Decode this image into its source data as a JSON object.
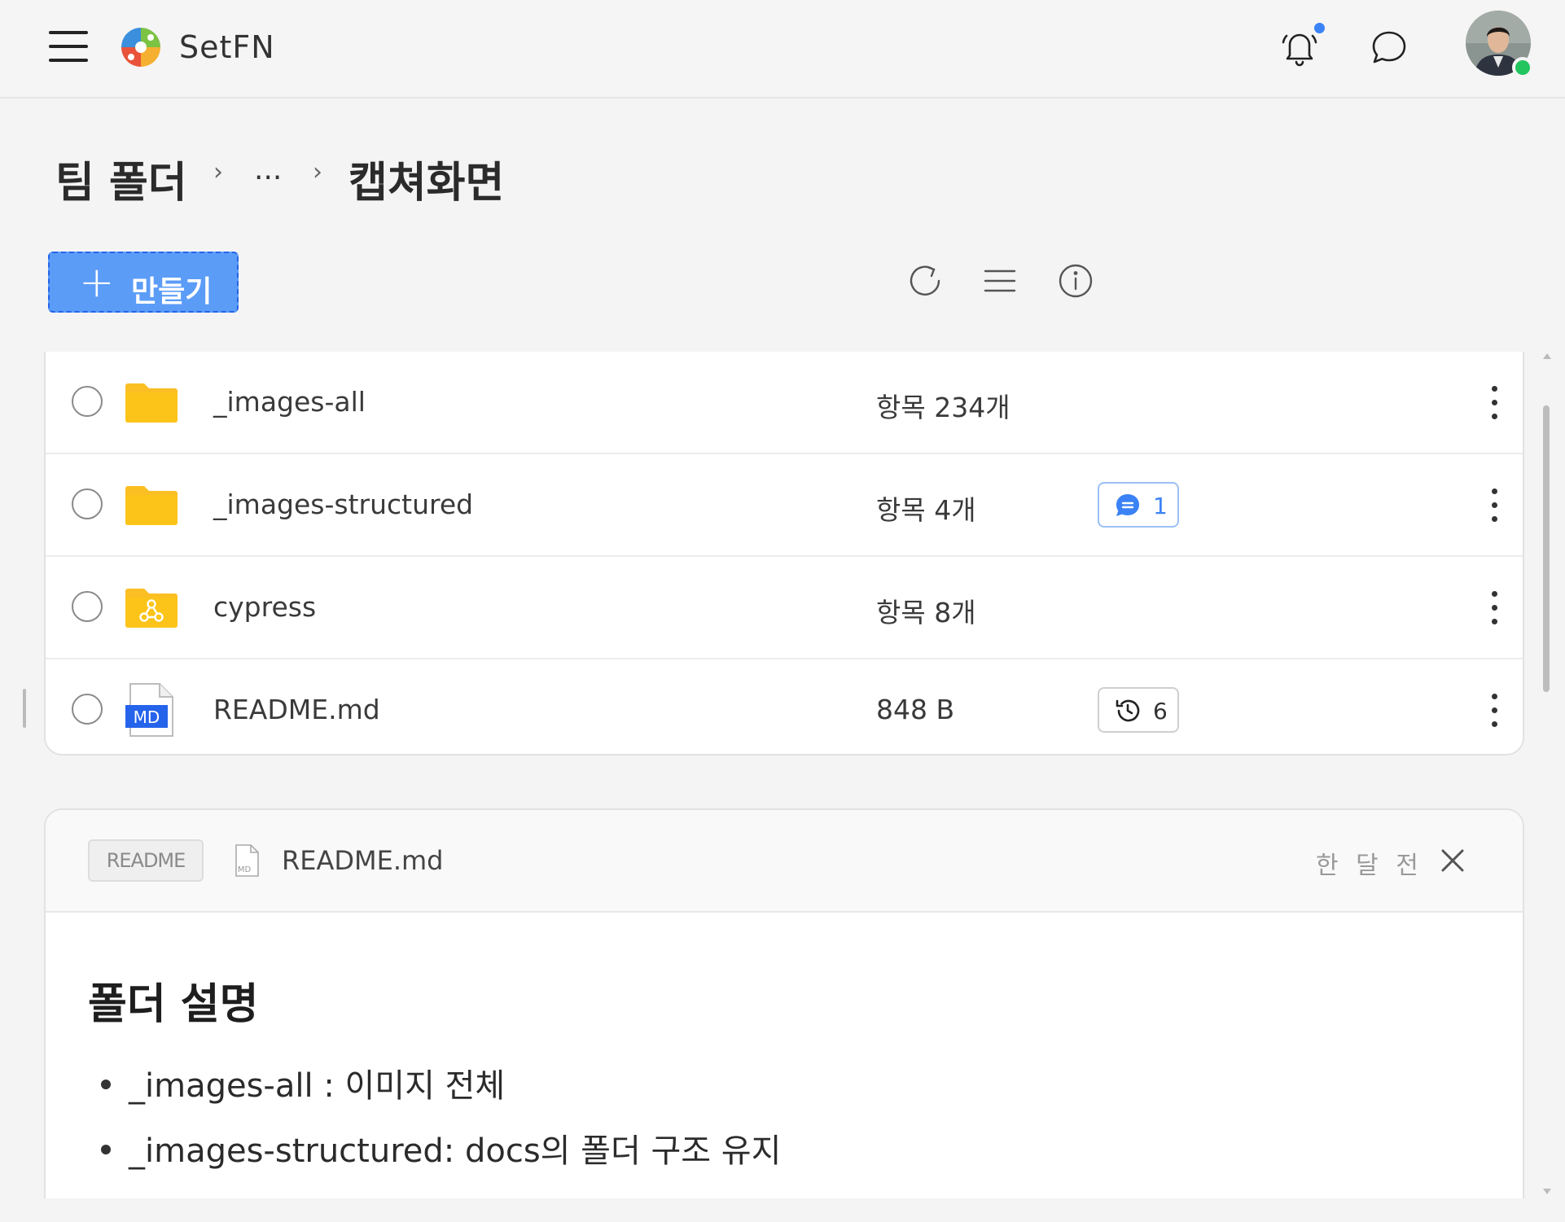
{
  "header": {
    "app_name": "SetFN",
    "icons": [
      "menu-icon",
      "logo-icon",
      "bell-icon",
      "chat-icon"
    ],
    "notification_dot_color": "#3b82f6",
    "online_status_color": "#22c55e"
  },
  "breadcrumb": {
    "root": "팀 폴더",
    "ellipsis": "...",
    "current": "캡쳐화면"
  },
  "toolbar": {
    "create_label": "만들기",
    "create_color": "#5b9cf7",
    "icons": [
      "refresh-icon",
      "list-view-icon",
      "info-icon"
    ]
  },
  "files": [
    {
      "name": "_images-all",
      "meta": "항목 234개",
      "type": "folder",
      "badge": null
    },
    {
      "name": "_images-structured",
      "meta": "항목 4개",
      "type": "folder",
      "badge": {
        "kind": "comment",
        "count": "1"
      }
    },
    {
      "name": "cypress",
      "meta": "항목 8개",
      "type": "shared-folder",
      "badge": null
    },
    {
      "name": "README.md",
      "meta": "848 B",
      "type": "markdown",
      "file_icon_label": "MD",
      "badge": {
        "kind": "history",
        "count": "6"
      }
    }
  ],
  "readme": {
    "tag": "README",
    "file_icon_label": "MD",
    "file_name": "README.md",
    "time": "한 달 전",
    "heading": "폴더 설명",
    "items": [
      "_images-all : 이미지 전체",
      "_images-structured: docs의 폴더 구조 유지"
    ]
  }
}
